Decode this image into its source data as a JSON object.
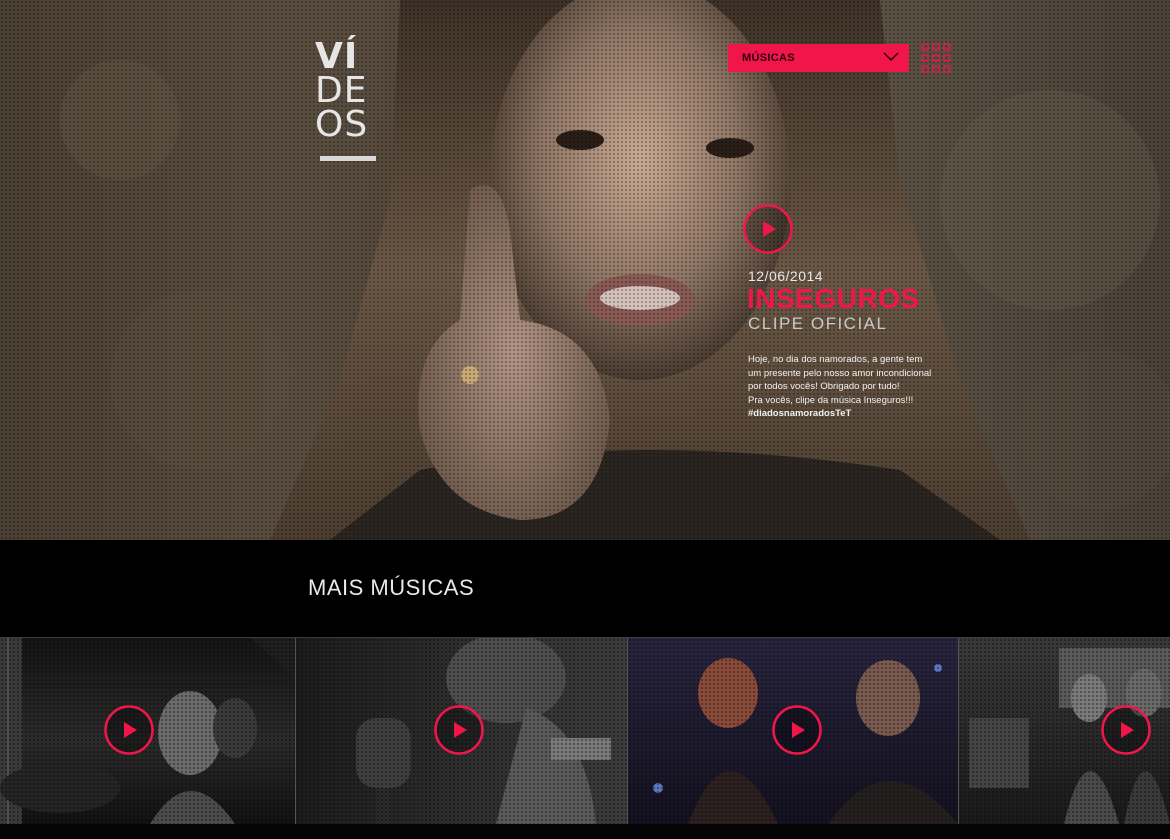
{
  "logo": {
    "line1": "VÍ",
    "line2": "DE",
    "line3": "OS"
  },
  "header": {
    "dropdown_label": "MÚSICAS",
    "grid_icon": "grid-icon",
    "dropdown_icon": "chevron-down-icon"
  },
  "featured": {
    "date": "12/06/2014",
    "title": "INSEGUROS",
    "subtitle": "CLIPE OFICIAL",
    "description_lines": [
      "Hoje, no dia dos namorados, a gente tem",
      "um presente pelo nosso amor incondicional",
      "por todos vocês! Obrigado por tudo!",
      "Pra vocês, clipe da música Inseguros!!!"
    ],
    "hashtag": "#diadosnamoradosTeT",
    "play_icon": "play-icon"
  },
  "more": {
    "title": "MAIS MÚSICAS",
    "videos": [
      {
        "name": "video-1",
        "play_icon": "play-icon"
      },
      {
        "name": "video-2",
        "play_icon": "play-icon"
      },
      {
        "name": "video-3",
        "play_icon": "play-icon"
      },
      {
        "name": "video-4",
        "play_icon": "play-icon"
      }
    ]
  },
  "colors": {
    "accent": "#f0164a",
    "background": "#000000",
    "text": "#e8e8e8"
  }
}
